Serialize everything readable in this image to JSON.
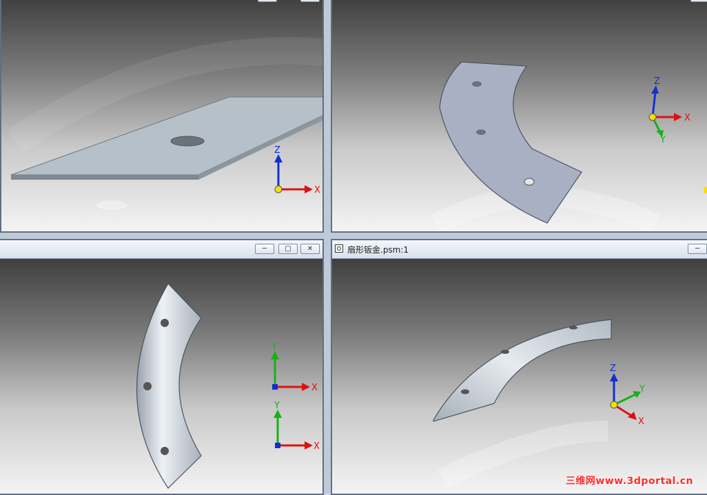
{
  "panes": {
    "top_right": {
      "title": ""
    },
    "bottom_left": {
      "title": ""
    },
    "bottom_right": {
      "title": "扇形钣金.psm:1"
    }
  },
  "axes": {
    "x": "X",
    "y": "Y",
    "z": "Z"
  },
  "window_controls": {
    "minimize": "─",
    "restore": "□",
    "close": "✕"
  },
  "watermark": "三维网www.3dportal.cn",
  "colors": {
    "x_axis": "#e01010",
    "y_axis": "#18b018",
    "z_axis": "#1030d0",
    "origin": "#f2e000"
  }
}
